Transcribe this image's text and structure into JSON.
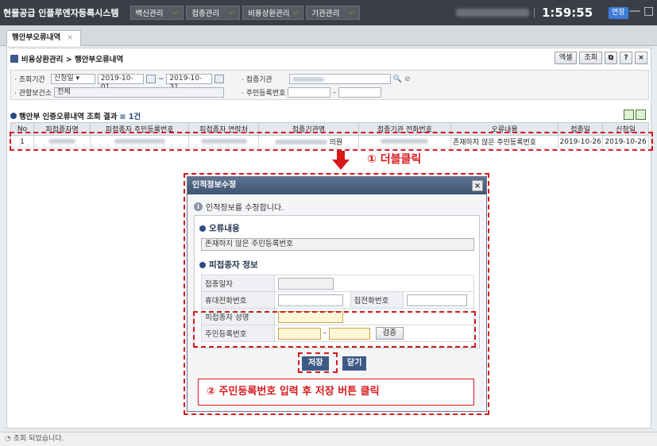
{
  "titlebar": {
    "app_title": "현물공급 인플루엔자등록시스템",
    "menus": [
      "백신관리",
      "접종관리",
      "비용상환관리",
      "기관관리"
    ],
    "clock": "1:59:55",
    "extend_label": "연장",
    "min_glyph": "—",
    "max_glyph": "□",
    "close_glyph": "×"
  },
  "tab": {
    "label": "행안부오류내역",
    "close": "×"
  },
  "header": {
    "breadcrumb": "비용상환관리 > 행안부오류내역",
    "buttons": {
      "excel": "엑셀",
      "search": "조회",
      "help": "?",
      "close": "×",
      "popout": "⧉"
    }
  },
  "search": {
    "period_label": "· 조회기간",
    "period_type": "신청일",
    "date_from": "2019-10-01",
    "date_to": "2019-10-31",
    "tilde": "~",
    "org_label": "· 접종기관",
    "health_center_label": "· 관할보건소",
    "health_center_value": "전체",
    "rrn_label": "· 주민등록번호",
    "dash": "-"
  },
  "grid": {
    "title": "행안부 인증오류내역 조회 결과",
    "count": "≡ 1건",
    "columns": [
      "No",
      "피접종자명",
      "피접종자 주민등록번호",
      "피접종자 연락처",
      "접종기관명",
      "접종기관 전화번호",
      "오류내용",
      "접종일",
      "신청일"
    ],
    "rows": [
      {
        "no": "1",
        "org_suffix": "의원",
        "error": "존재하지 않은 주민등록번호",
        "vacc_date": "2019-10-26",
        "req_date": "2019-10-26"
      }
    ]
  },
  "annotation1": "① 더블클릭",
  "dialog": {
    "title": "인적정보수정",
    "close": "×",
    "message": "인적정보를 수정합니다.",
    "section_error": "오류내용",
    "error_value": "존재하지 않은 주민등록번호",
    "section_person": "피접종자 정보",
    "labels": {
      "vacc_date": "접종일자",
      "mobile": "휴대전화번호",
      "home_phone": "집전화번호",
      "name": "피접종자 성명",
      "rrn": "주민등록번호"
    },
    "verify_button": "검증",
    "save_button": "저장",
    "close_button": "닫기",
    "dash": "-"
  },
  "annotation2": "② 주민등록번호 입력 후 저장 버튼 클릭",
  "status": "조회 되었습니다.",
  "colors": {
    "accent_red": "#d7191c",
    "titlebar": "#3a3f47",
    "dialog_head": "#4a5f80",
    "menu_chevron": "#f5a623"
  }
}
